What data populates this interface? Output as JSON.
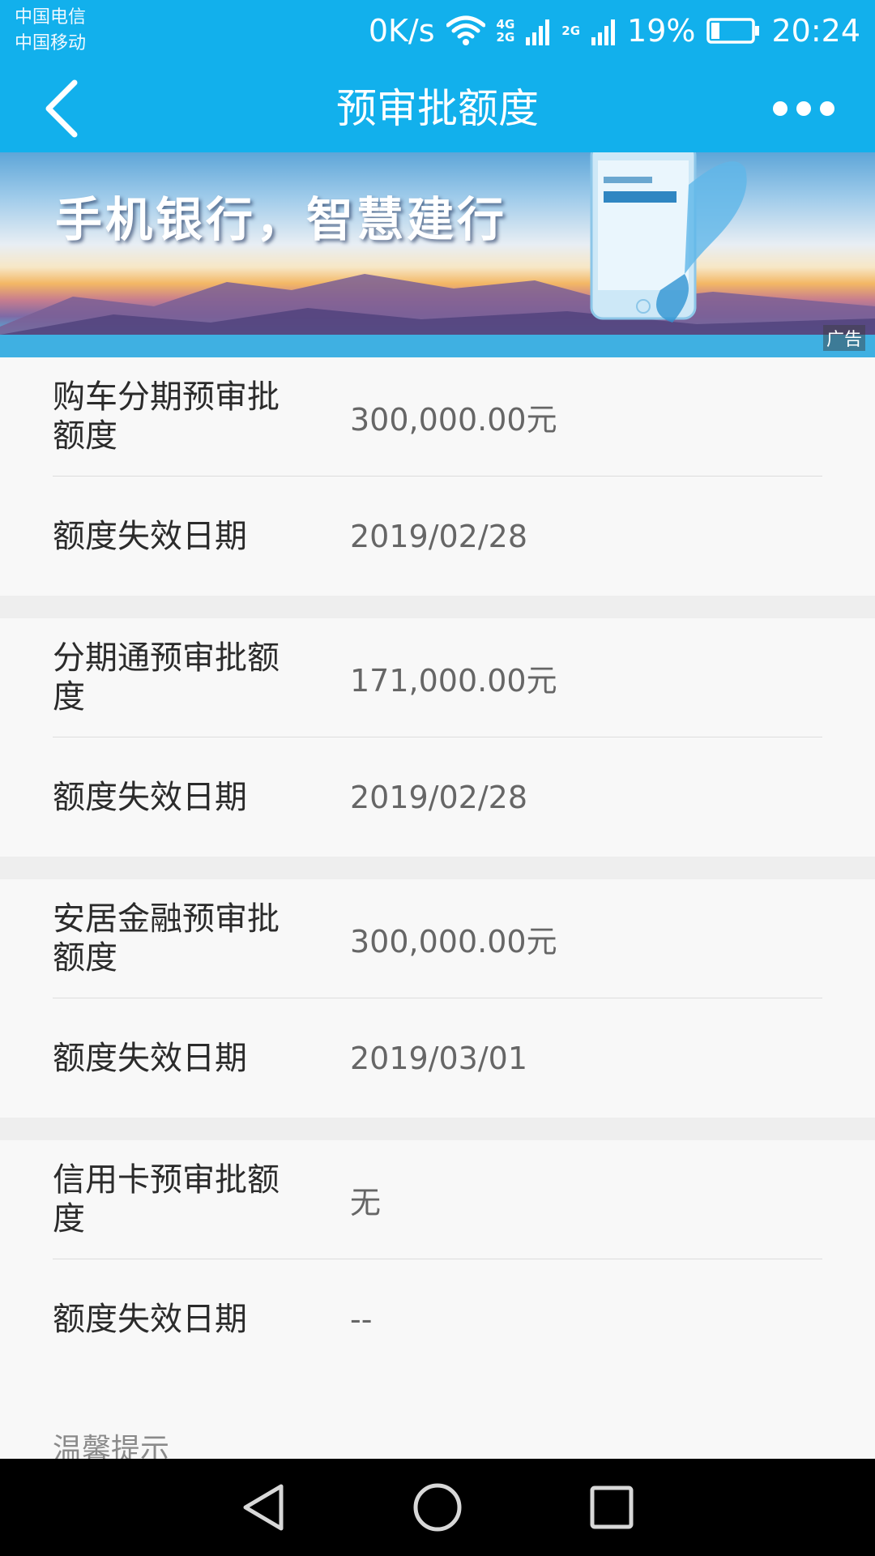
{
  "status_bar": {
    "carrier_1": "中国电信",
    "carrier_2": "中国移动",
    "net_speed": "0K/s",
    "net_tag_top": "4G",
    "net_tag_bottom": "2G",
    "net_tag_2": "2G",
    "battery": "19%",
    "time": "20:24"
  },
  "header": {
    "title": "预审批额度",
    "back_icon": "chevron-left-icon",
    "more_icon": "more-horizontal-icon",
    "background": "#12b0ec"
  },
  "banner": {
    "slogan": "手机银行，智慧建行",
    "ad_tag": "广告"
  },
  "sections": [
    {
      "amount_label": "购车分期预审批额度",
      "amount_value": "300,000.00元",
      "expiry_label": "额度失效日期",
      "expiry_value": "2019/02/28"
    },
    {
      "amount_label": "分期通预审批额度",
      "amount_value": "171,000.00元",
      "expiry_label": "额度失效日期",
      "expiry_value": "2019/02/28"
    },
    {
      "amount_label": "安居金融预审批额度",
      "amount_value": "300,000.00元",
      "expiry_label": "额度失效日期",
      "expiry_value": "2019/03/01"
    },
    {
      "amount_label": "信用卡预审批额度",
      "amount_value": "无",
      "expiry_label": "额度失效日期",
      "expiry_value": "--"
    }
  ],
  "tips": {
    "label": "温馨提示"
  },
  "nav_bar": {
    "back_icon": "triangle-back-icon",
    "home_icon": "circle-home-icon",
    "recents_icon": "square-recents-icon"
  }
}
